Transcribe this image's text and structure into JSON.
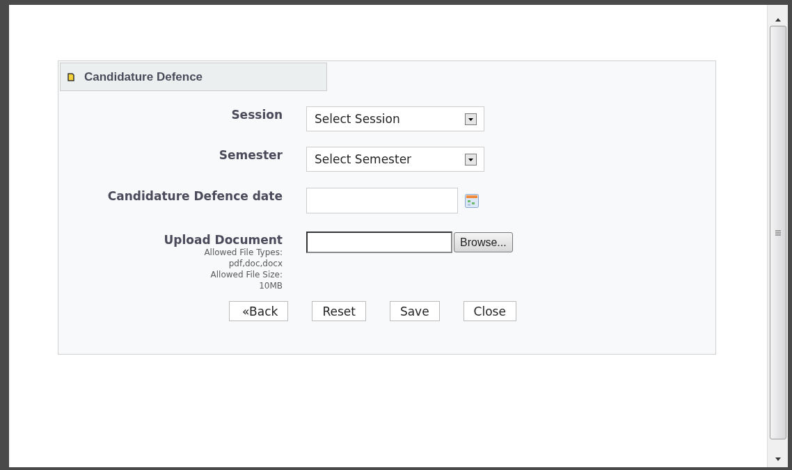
{
  "panel": {
    "title": "Candidature Defence"
  },
  "fields": [
    {
      "kind": "select",
      "label": "Session",
      "value": "Select Session"
    },
    {
      "kind": "select",
      "label": "Semester",
      "value": "Select Semester"
    },
    {
      "kind": "date",
      "label": "Candidature Defence date"
    },
    {
      "kind": "file",
      "label": "Upload Document",
      "button": "Browse...",
      "hints": [
        "Allowed File Types:",
        "pdf,doc,docx",
        "Allowed File Size:",
        "10MB"
      ]
    }
  ],
  "buttons": [
    "«Back",
    "Reset",
    "Save",
    "Close"
  ]
}
